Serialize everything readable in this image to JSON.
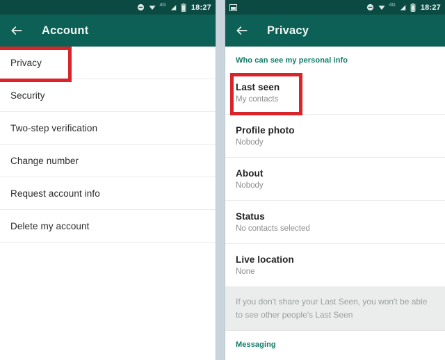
{
  "theme": {
    "statusbar_bg": "#0a4a42",
    "appbar_bg": "#0c6055",
    "accent_teal": "#0f7a68",
    "highlight_red": "#d9252a",
    "footnote_bg": "#ebeded"
  },
  "left_screen": {
    "statusbar": {
      "icons": [
        "do-not-disturb-icon",
        "wifi-icon",
        "signal-icon",
        "battery-icon"
      ],
      "network_label": "4G",
      "clock": "18:27"
    },
    "appbar": {
      "back_icon": "back-arrow-icon",
      "title": "Account"
    },
    "items": [
      {
        "label": "Privacy"
      },
      {
        "label": "Security"
      },
      {
        "label": "Two-step verification"
      },
      {
        "label": "Change number"
      },
      {
        "label": "Request account info"
      },
      {
        "label": "Delete my account"
      }
    ],
    "highlight": {
      "target": "Privacy"
    }
  },
  "right_screen": {
    "statusbar": {
      "notification_icon": "image-notification-icon",
      "icons": [
        "do-not-disturb-icon",
        "wifi-icon",
        "signal-icon",
        "battery-icon"
      ],
      "network_label": "4G",
      "clock": "18:27"
    },
    "appbar": {
      "back_icon": "back-arrow-icon",
      "title": "Privacy"
    },
    "section_personal_info": "Who can see my personal info",
    "items": [
      {
        "label": "Last seen",
        "value": "My contacts"
      },
      {
        "label": "Profile photo",
        "value": "Nobody"
      },
      {
        "label": "About",
        "value": "Nobody"
      },
      {
        "label": "Status",
        "value": "No contacts selected"
      },
      {
        "label": "Live location",
        "value": "None"
      }
    ],
    "footnote": "If you don't share your Last Seen, you won't be able to see other people's Last Seen",
    "section_messaging": "Messaging",
    "highlight": {
      "target": "Last seen"
    }
  }
}
